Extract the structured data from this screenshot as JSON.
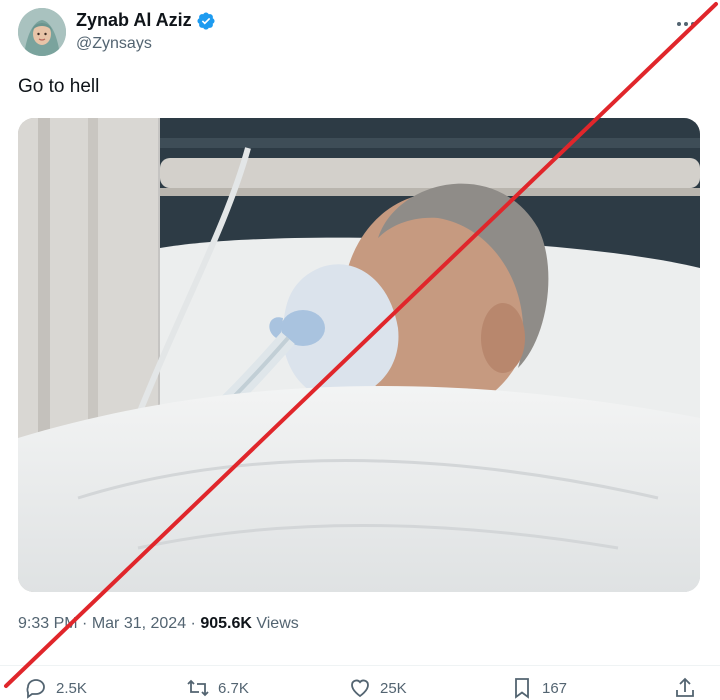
{
  "author": {
    "name": "Zynab Al Aziz",
    "handle": "@Zynsays"
  },
  "tweet": {
    "text": "Go to hell"
  },
  "meta": {
    "time": "9:33 PM",
    "sep1": " · ",
    "date": "Mar 31, 2024",
    "sep2": " · ",
    "views_count": "905.6K",
    "views_label": " Views"
  },
  "actions": {
    "replies": "2.5K",
    "reposts": "6.7K",
    "likes": "25K",
    "bookmarks": "167"
  },
  "icons": {
    "verified": "verified-badge-icon",
    "more": "more-horizontal-icon",
    "reply": "reply-icon",
    "repost": "repost-icon",
    "like": "heart-icon",
    "bookmark": "bookmark-icon",
    "share": "share-icon"
  },
  "colors": {
    "verified": "#1d9bf0",
    "overlay_line": "#e0262b",
    "secondary_text": "#536471"
  }
}
